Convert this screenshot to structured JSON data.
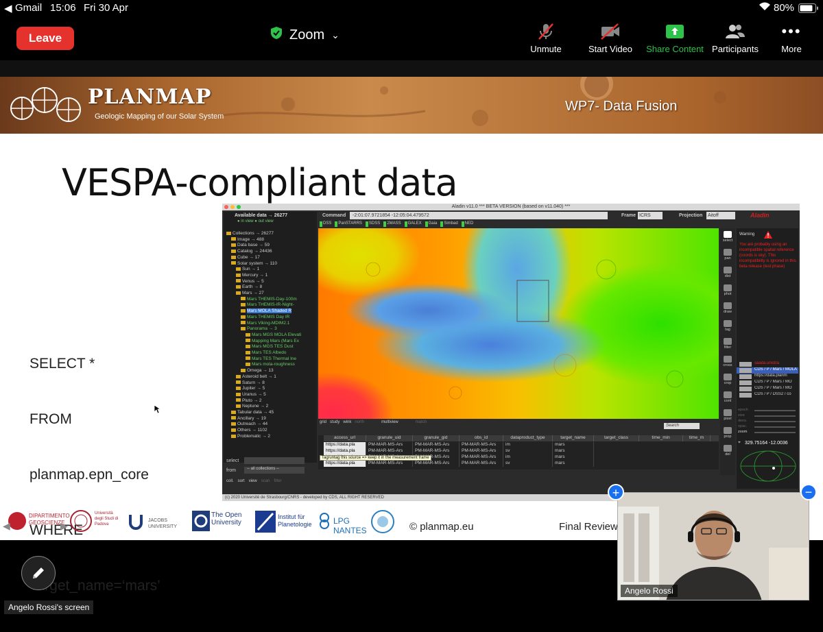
{
  "status_bar": {
    "back_app": "Gmail",
    "time": "15:06",
    "date": "Fri 30 Apr",
    "battery": "80%",
    "icons": [
      "back-arrow-icon",
      "wifi-icon",
      "battery-icon"
    ]
  },
  "zoom_toolbar": {
    "leave_label": "Leave",
    "app_title": "Zoom",
    "items": [
      {
        "label": "Unmute",
        "icon": "muted-microphone-icon"
      },
      {
        "label": "Start Video",
        "icon": "video-off-icon"
      },
      {
        "label": "Share Content",
        "icon": "share-icon"
      },
      {
        "label": "Participants",
        "icon": "participants-icon"
      },
      {
        "label": "More",
        "icon": "more-icon"
      }
    ],
    "colors": {
      "leave": "#e5322d",
      "share": "#2ec24a",
      "shield": "#2ec24a"
    }
  },
  "slide": {
    "banner": {
      "logo_title": "PLANMAP",
      "logo_subtitle": "Geologic Mapping of our Solar System",
      "section": "WP7- Data Fusion"
    },
    "title": "VESPA-compliant data",
    "sql_lines": [
      "SELECT *",
      "FROM",
      "planmap.epn_core",
      "WHERE",
      "Target_name=‘mars’"
    ],
    "footer": {
      "logos": [
        "DIPARTIMENTO GEOSCIENZE",
        "Università degli Studi di Padova",
        "JACOBS UNIVERSITY",
        "The Open University",
        "Institut für Planetologie",
        "LPG NANTES"
      ],
      "copyright": "© planmap.eu",
      "final_review": "Final Review"
    }
  },
  "aladin": {
    "window_title": "Aladin v11.0   *** BETA VERSION (based on v11.040) ***",
    "available_data_label": "Available data → 26277",
    "in_view_label": "● in view ● out view",
    "command_label": "Command",
    "command_value": "-2:01:07.9721854 -12:05:04.479572",
    "frame_label": "Frame",
    "frame_value": "ICRS",
    "projection_label": "Projection",
    "projection_value": "Aitoff",
    "surveys": [
      "DSS",
      "PanSTARRS",
      "SDSS",
      "2MASS",
      "GALEX",
      "Gaia",
      "Simbad",
      "NED"
    ],
    "tree": [
      "Collections → 26277",
      "Image → 488",
      "Data base → 59",
      "Catalog → 24436",
      "Cube → 17",
      "Solar system → 110",
      "Sun → 1",
      "Mercury → 1",
      "Venus → 5",
      "Earth → 8",
      "Mars → 27",
      "Mars THEMIS-Day-100m",
      "Mars THEMIS-IR-Night-",
      "Mars MOLA Shaded R",
      "Mars THEMIS Day IR",
      "Mars Viking-MDIM2.1",
      "Panorama → 3",
      "Mars MGS MOLA Elevati",
      "Mapping Mars (Mars Ex",
      "Mars MGS TES Dust",
      "Mars TES Albedo",
      "Mars TES Thermal Ine",
      "Mars mola-roughness",
      "Omega → 13",
      "Asteroid belt → 1",
      "Saturn → 8",
      "Jupiter → 5",
      "Uranus → 5",
      "Pluto → 2",
      "Neptune → 2",
      "Tabular data → 45",
      "Ancillary → 19",
      "Outreach → 44",
      "Others → 1102",
      "Problematic → 2"
    ],
    "select_label": "select",
    "from_label": "from",
    "from_value": "-- all collections --",
    "left_buttons": [
      "coll.",
      "sort",
      "view",
      "scan",
      "filter"
    ],
    "map_tools": [
      "grid",
      "study",
      "wink",
      "north",
      "multiview",
      "match"
    ],
    "tools": [
      "select",
      "pan",
      "dist",
      "phot",
      "draw",
      "tag",
      "filter",
      "cross",
      "crop",
      "cont",
      "pixel",
      "prop",
      "del"
    ],
    "warning_title": "Warning",
    "warning_text": "You are probably using an incompatible spatial reference (coords is sky). This incompatibility is ignored in this beta release (test phase)",
    "layers": [
      "saada.unistra",
      "CDS / P / Mars / MOLA",
      "https://data.planm",
      "CDS / P / Mars / MO",
      "CDS / P / Mars / MO",
      "CDS / P / DSS2 / co"
    ],
    "search_placeholder": "Search",
    "sliders": [
      "epoch",
      "size",
      "dens.",
      "opac.",
      "zoom"
    ],
    "coords": "329.75164 -12.0036",
    "table_headers": [
      "access_url",
      "granule_uid",
      "granule_gid",
      "obs_id",
      "dataproduct_type",
      "target_name",
      "target_class",
      "time_min",
      "time_m"
    ],
    "table_rows": [
      [
        "https://data.pla",
        "PM-MAR-MS-Ars",
        "PM-MAR-MS-Ars",
        "PM-MAR-MS-Ars",
        "im",
        "mars"
      ],
      [
        "https://data.pla",
        "PM-MAR-MS-Ars",
        "PM-MAR-MS-Ars",
        "PM-MAR-MS-Ars",
        "sv",
        "mars"
      ],
      [
        "https://data.pla",
        "PM-MAR-MS-Ars",
        "PM-MAR-MS-Ars",
        "PM-MAR-MS-Ars",
        "im",
        "mars"
      ],
      [
        "https://data.pla",
        "PM-MAR-MS-Ars",
        "PM-MAR-MS-Ars",
        "PM-MAR-MS-Ars",
        "sv",
        "mars"
      ]
    ],
    "tooltip": "Tag/untag this source => keep it in the measurement frame",
    "copyright": "(c) 2020 Université de Strasbourg/CNRS - developed by CDS, ALL RIGHT RESERVED",
    "logo": "Aladin"
  },
  "video": {
    "participant_name": "Angelo Rossi"
  },
  "screen_owner": "Angelo Rossi's screen"
}
